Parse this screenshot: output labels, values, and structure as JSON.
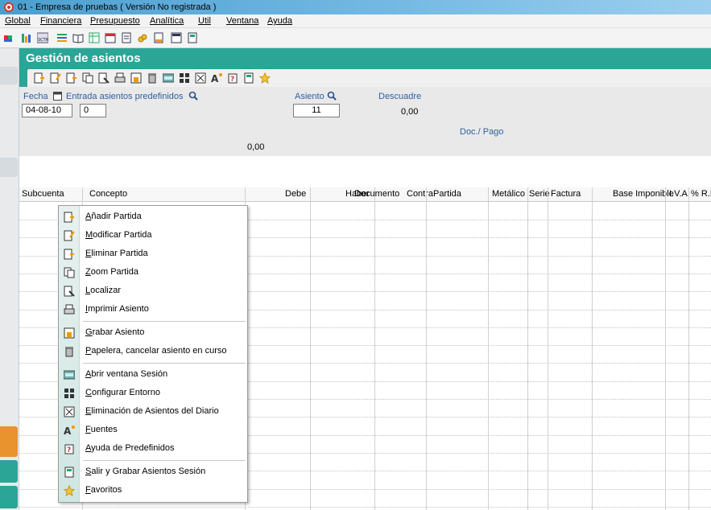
{
  "window": {
    "title": "01 - Empresa de pruebas    ( Versión No registrada )"
  },
  "menubar": {
    "items": [
      {
        "label": "Global"
      },
      {
        "label": "Financiera"
      },
      {
        "label": "Presupuesto"
      },
      {
        "label": "Analítica"
      },
      {
        "label": "Util"
      },
      {
        "label": "Ventana"
      },
      {
        "label": "Ayuda"
      }
    ]
  },
  "panel": {
    "title": "Gestión de asientos"
  },
  "form": {
    "fecha_label": "Fecha",
    "fecha_value": "04-08-10",
    "predef_label": "Entrada asientos predefinidos",
    "predef_value": "0",
    "asiento_label": "Asiento",
    "asiento_value": "11",
    "descuadre_label": "Descuadre",
    "descuadre_value": "0,00",
    "docpago_label": "Doc./ Pago",
    "total_value": "0,00"
  },
  "grid": {
    "columns": [
      "Subcuenta",
      "Concepto",
      "Debe",
      "Haber",
      "Documento",
      "ContraPartida",
      "Metálico",
      "Serie",
      "Factura",
      "Base Imponible",
      "I.V.A.",
      "% R.E"
    ]
  },
  "context_menu": {
    "items": [
      {
        "label": "Añadir Partida",
        "icon": "add-entry-icon"
      },
      {
        "label": "Modificar Partida",
        "icon": "edit-entry-icon"
      },
      {
        "label": "Eliminar Partida",
        "icon": "delete-entry-icon"
      },
      {
        "label": "Zoom Partida",
        "icon": "zoom-entry-icon"
      },
      {
        "label": "Localizar",
        "icon": "locate-icon"
      },
      {
        "label": "Imprimir Asiento",
        "icon": "print-icon"
      },
      {
        "label": "Grabar Asiento",
        "icon": "save-icon"
      },
      {
        "label": "Papelera, cancelar asiento en curso",
        "icon": "trash-icon"
      },
      {
        "label": "Abrir ventana Sesión",
        "icon": "session-icon"
      },
      {
        "label": "Configurar Entorno",
        "icon": "configure-icon"
      },
      {
        "label": "Eliminación de Asientos del Diario",
        "icon": "delete-journal-icon"
      },
      {
        "label": "Fuentes",
        "icon": "fonts-icon"
      },
      {
        "label": "Ayuda de Predefinidos",
        "icon": "help-predefined-icon"
      },
      {
        "label": "Salir y Grabar Asientos Sesión",
        "icon": "exit-save-icon"
      },
      {
        "label": "Favoritos",
        "icon": "star-icon"
      }
    ]
  },
  "colors": {
    "accent": "#2aa596",
    "label_blue": "#2d5fa0",
    "title_bar": "#74b9e3"
  }
}
